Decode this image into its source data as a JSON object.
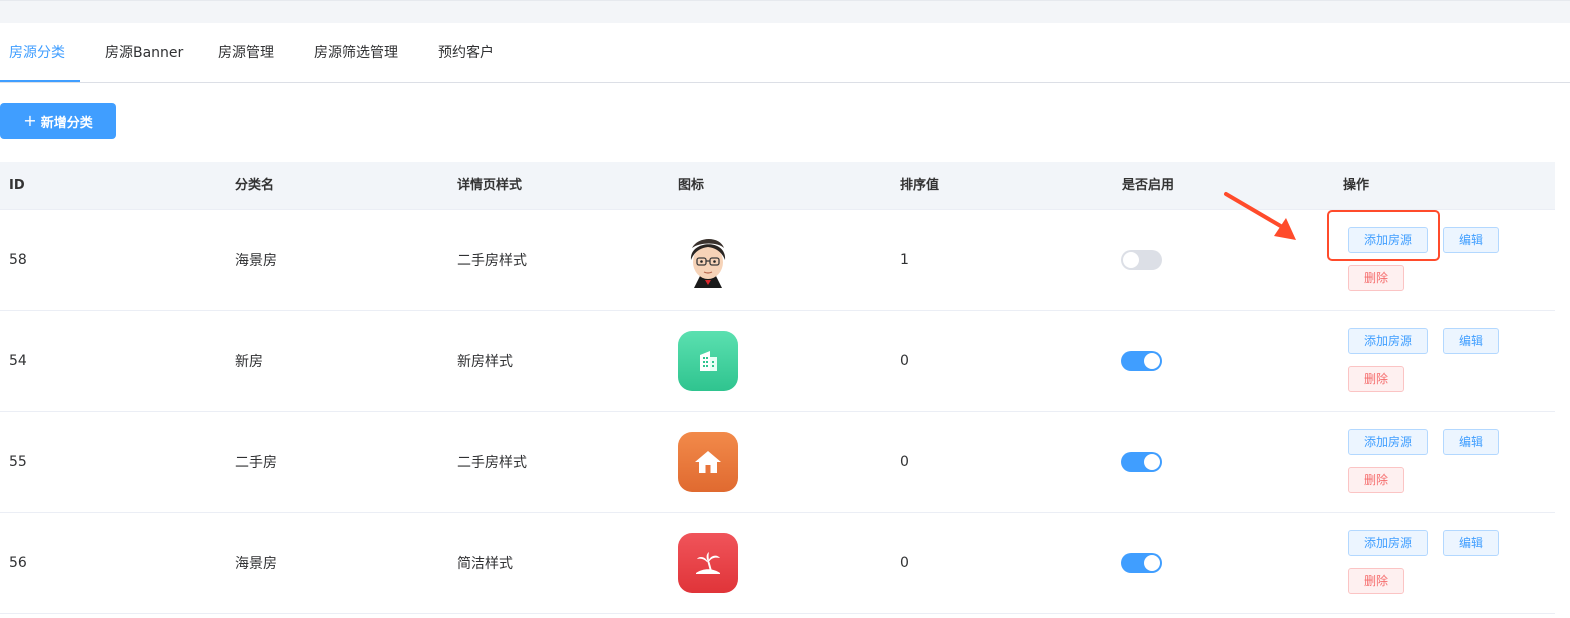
{
  "tabs": [
    "房源分类",
    "房源Banner",
    "房源管理",
    "房源筛选管理",
    "预约客户"
  ],
  "active_tab": 0,
  "toolbar": {
    "add_icon": "+",
    "add_label": "新增分类"
  },
  "table": {
    "headers": [
      "ID",
      "分类名",
      "详情页样式",
      "图标",
      "排序值",
      "是否启用",
      "操作"
    ],
    "rows": [
      {
        "id": "58",
        "name": "海景房",
        "style": "二手房样式",
        "icon": "avatar-icon",
        "sort": "1",
        "enabled": false
      },
      {
        "id": "54",
        "name": "新房",
        "style": "新房样式",
        "icon": "building-icon",
        "sort": "0",
        "enabled": true
      },
      {
        "id": "55",
        "name": "二手房",
        "style": "二手房样式",
        "icon": "home-icon",
        "sort": "0",
        "enabled": true
      },
      {
        "id": "56",
        "name": "海景房",
        "style": "简洁样式",
        "icon": "palm-tree-icon",
        "sort": "0",
        "enabled": true
      }
    ],
    "actions": {
      "add_house": "添加房源",
      "edit": "编辑",
      "delete": "删除"
    }
  },
  "colors": {
    "primary": "#409eff",
    "danger": "#f56c6c",
    "annotation": "#ff4b2b",
    "icon_green": "#3ecf9d",
    "icon_orange": "#e8743b",
    "icon_red": "#ea3f44"
  }
}
